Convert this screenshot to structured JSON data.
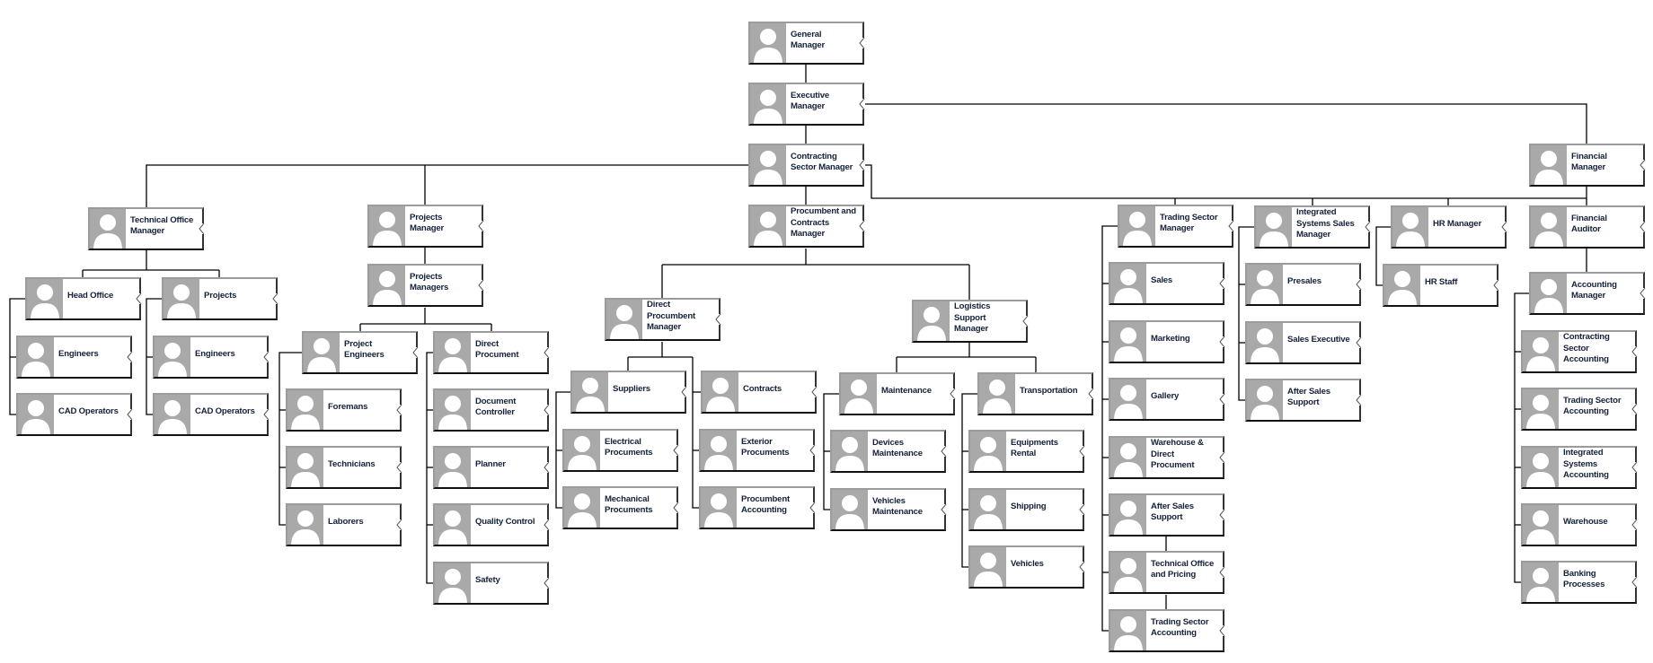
{
  "chart_title": "",
  "colors": {
    "photo_background": "#a9a9a9",
    "connector": "#000000",
    "label_text": "#14213a",
    "box_fill": "#ffffff"
  },
  "icons": {
    "avatar": "person-silhouette-icon",
    "notch": "collapse-chevron-icon"
  },
  "nodes": {
    "general_manager": "General Manager",
    "executive_manager": "Executive Manager",
    "contracting_sector_manager": "Contracting Sector Manager",
    "financial_manager": "Financial Manager",
    "technical_office_manager": "Technical Office Manager",
    "head_office": "Head Office",
    "projects": "Projects",
    "head_office_engineers": "Engineers",
    "head_office_cad_operators": "CAD Operators",
    "projects_engineers": "Engineers",
    "projects_cad_operators": "CAD Operators",
    "projects_manager": "Projects Manager",
    "projects_managers": "Projects Managers",
    "project_engineers": "Project Engineers",
    "direct_procument": "Direct Procument",
    "foremans": "Foremans",
    "technicians": "Technicians",
    "laborers": "Laborers",
    "document_controller": "Document Controller",
    "planner": "Planner",
    "quality_control": "Quality Control",
    "safety": "Safety",
    "procumbent_contracts_manager": "Procumbent and Contracts Manager",
    "direct_procumbent_manager": "Direct Procumbent Manager",
    "suppliers": "Suppliers",
    "contracts": "Contracts",
    "electrical_procuments": "Electrical Procuments",
    "mechanical_procuments": "Mechanical Procuments",
    "exterior_procuments": "Exterior Procuments",
    "procumbent_accounting": "Procumbent Accounting",
    "logistics_support_manager": "Logistics Support Manager",
    "maintenance": "Maintenance",
    "transportation": "Transportation",
    "devices_maintenance": "Devices Maintenance",
    "vehicles_maintenance": "Vehicles Maintenance",
    "equipments_rental": "Equipments Rental",
    "shipping": "Shipping",
    "vehicles": "Vehicles",
    "trading_sector_manager": "Trading Sector Manager",
    "sales": "Sales",
    "marketing": "Marketing",
    "gallery": "Gallery",
    "warehouse_direct_procument": "Warehouse & Direct Procument",
    "trading_after_sales_support": "After Sales Support",
    "technical_office_pricing": "Technical Office and Pricing",
    "trading_sector_accounting_t": "Trading Sector Accounting",
    "integrated_systems_sales_manager": "Integrated Systems Sales Manager",
    "presales": "Presales",
    "sales_executive": "Sales Executive",
    "integrated_after_sales_support": "After Sales Support",
    "hr_manager": "HR Manager",
    "hr_staff": "HR Staff",
    "financial_auditor": "Financial Auditor",
    "accounting_manager": "Accounting Manager",
    "contracting_sector_accounting": "Contracting Sector Accounting",
    "trading_sector_accounting_f": "Trading Sector Accounting",
    "integrated_systems_accounting": "Integrated Systems Accounting",
    "warehouse": "Warehouse",
    "banking_processes": "Banking Processes"
  }
}
